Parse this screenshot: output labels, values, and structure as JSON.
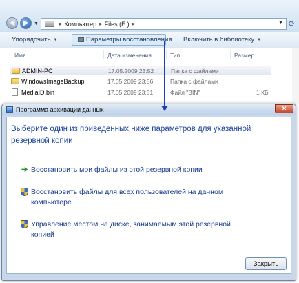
{
  "explorer": {
    "address": {
      "segments": [
        "Компьютер",
        "Files (E:)"
      ],
      "separator": "▸"
    },
    "toolbar": {
      "organize": "Упорядочить",
      "restore_settings": "Параметры восстановления",
      "include_in_library": "Включить в библиотеку",
      "caret": "▼"
    },
    "columns": {
      "name": "Имя",
      "date_modified": "Дата изменения",
      "type": "Тип",
      "size": "Размер"
    },
    "files": [
      {
        "name": "ADMIN-PC",
        "date": "17.05.2009 23:52",
        "type": "Папка с файлами",
        "size": "",
        "icon": "folder-icon"
      },
      {
        "name": "WindowsImageBackup",
        "date": "17.05.2009 23:56",
        "type": "Папка с файлами",
        "size": "",
        "icon": "folder-icon"
      },
      {
        "name": "MediaID.bin",
        "date": "17.05.2009 23:51",
        "type": "Файл \"BIN\"",
        "size": "1 КБ",
        "icon": "file-icon"
      }
    ]
  },
  "dialog": {
    "title": "Программа архивации данных",
    "close_glyph": "✕",
    "heading": "Выберите один из приведенных ниже параметров для указанной резервной копии",
    "options": [
      {
        "label": "Восстановить мои файлы из этой резервной копии",
        "icon": "green-arrow-icon"
      },
      {
        "label": "Восстановить файлы для всех пользователей на данном компьютере",
        "icon": "shield-icon"
      },
      {
        "label": "Управление местом на диске, занимаемым этой резервной копией",
        "icon": "shield-icon"
      }
    ],
    "close_button": "Закрыть"
  },
  "colors": {
    "link_blue": "#1a3b8c",
    "annotation_arrow": "#1a3fb8"
  }
}
